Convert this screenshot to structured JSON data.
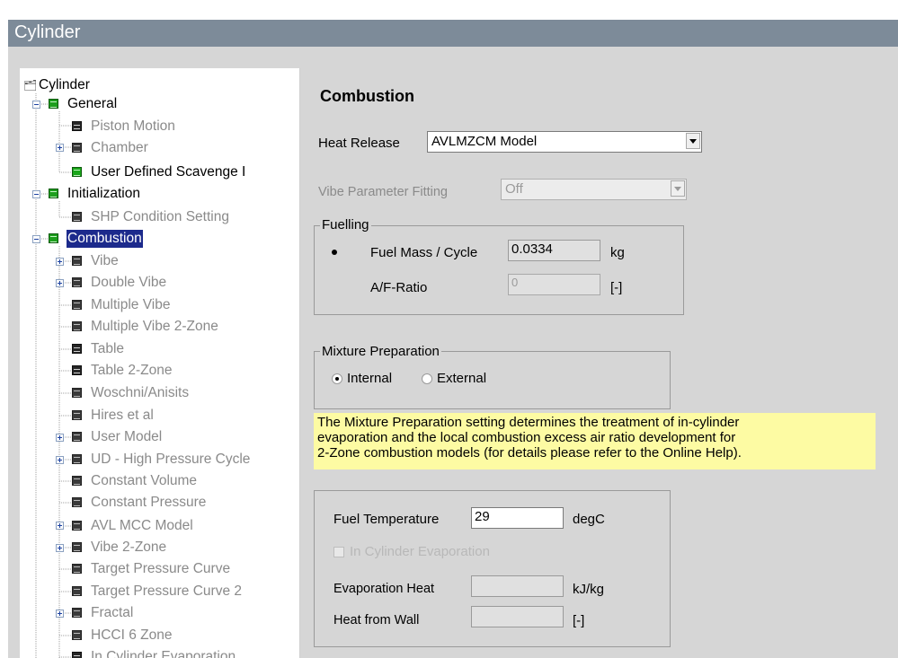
{
  "window": {
    "title": "Cylinder"
  },
  "tree": {
    "items": [
      {
        "label": "Cylinder",
        "icon": "hierarchy-icon",
        "state": "normal"
      },
      {
        "label": "General",
        "icon": "green-table-icon",
        "state": "normal"
      },
      {
        "label": "Piston Motion",
        "icon": "table-icon",
        "state": "disabled"
      },
      {
        "label": "Chamber",
        "icon": "table-icon",
        "state": "disabled"
      },
      {
        "label": "User Defined Scavenge I",
        "icon": "green-table-icon",
        "state": "normal"
      },
      {
        "label": "Initialization",
        "icon": "green-table-icon",
        "state": "normal"
      },
      {
        "label": "SHP Condition Setting",
        "icon": "table-icon",
        "state": "disabled"
      },
      {
        "label": "Combustion",
        "icon": "green-table-icon",
        "state": "selected"
      },
      {
        "label": "Vibe",
        "icon": "table-icon",
        "state": "disabled"
      },
      {
        "label": "Double Vibe",
        "icon": "table-icon",
        "state": "disabled"
      },
      {
        "label": "Multiple Vibe",
        "icon": "table-icon",
        "state": "disabled"
      },
      {
        "label": "Multiple Vibe 2-Zone",
        "icon": "table-icon",
        "state": "disabled"
      },
      {
        "label": "Table",
        "icon": "table-icon",
        "state": "disabled"
      },
      {
        "label": "Table 2-Zone",
        "icon": "table-icon",
        "state": "disabled"
      },
      {
        "label": "Woschni/Anisits",
        "icon": "table-icon",
        "state": "disabled"
      },
      {
        "label": "Hires et al",
        "icon": "table-icon",
        "state": "disabled"
      },
      {
        "label": "User Model",
        "icon": "table-icon",
        "state": "disabled"
      },
      {
        "label": "UD - High Pressure Cycle",
        "icon": "table-icon",
        "state": "disabled"
      },
      {
        "label": "Constant Volume",
        "icon": "table-icon",
        "state": "disabled"
      },
      {
        "label": "Constant Pressure",
        "icon": "table-icon",
        "state": "disabled"
      },
      {
        "label": "AVL MCC Model",
        "icon": "table-icon",
        "state": "disabled"
      },
      {
        "label": "Vibe 2-Zone",
        "icon": "table-icon",
        "state": "disabled"
      },
      {
        "label": "Target Pressure Curve",
        "icon": "table-icon",
        "state": "disabled"
      },
      {
        "label": "Target Pressure Curve 2",
        "icon": "table-icon",
        "state": "disabled"
      },
      {
        "label": "Fractal",
        "icon": "table-icon",
        "state": "disabled"
      },
      {
        "label": "HCCI 6 Zone",
        "icon": "table-icon",
        "state": "disabled"
      },
      {
        "label": "In Cylinder Evaporation",
        "icon": "table-icon",
        "state": "disabled"
      }
    ]
  },
  "section": {
    "title": "Combustion",
    "heat_release": {
      "label": "Heat Release",
      "value": "AVLMZCM Model"
    },
    "vibe_fitting": {
      "label": "Vibe Parameter Fitting",
      "value": "Off"
    },
    "fuelling": {
      "title": "Fuelling",
      "fuel_mass": {
        "label": "Fuel Mass / Cycle",
        "value": "0.0334",
        "unit": "kg",
        "selected": true
      },
      "af_ratio": {
        "label": "A/F-Ratio",
        "value": "0",
        "unit": "[-]",
        "selected": false
      }
    },
    "mixture": {
      "title": "Mixture Preparation",
      "internal": "Internal",
      "external": "External",
      "selected": "Internal"
    },
    "note": {
      "line1": "The Mixture Preparation setting determines the treatment of in-cylinder",
      "line2": "evaporation and the local combustion excess air ratio development for",
      "line3": "2-Zone combustion models (for details please refer to the Online Help)."
    },
    "fuel_temp": {
      "label": "Fuel Temperature",
      "value": "29",
      "unit": "degC"
    },
    "in_cyl_evap": {
      "label": "In Cylinder Evaporation",
      "checked": false
    },
    "evap_heat": {
      "label": "Evaporation Heat",
      "value": "",
      "unit": "kJ/kg"
    },
    "heat_wall": {
      "label": "Heat from Wall",
      "value": "",
      "unit": "[-]"
    }
  },
  "colors": {
    "titlebar": "#7d8b99",
    "panel": "#d6d6d6",
    "selection": "#1c2a8c",
    "note_bg": "#fdfba3"
  }
}
